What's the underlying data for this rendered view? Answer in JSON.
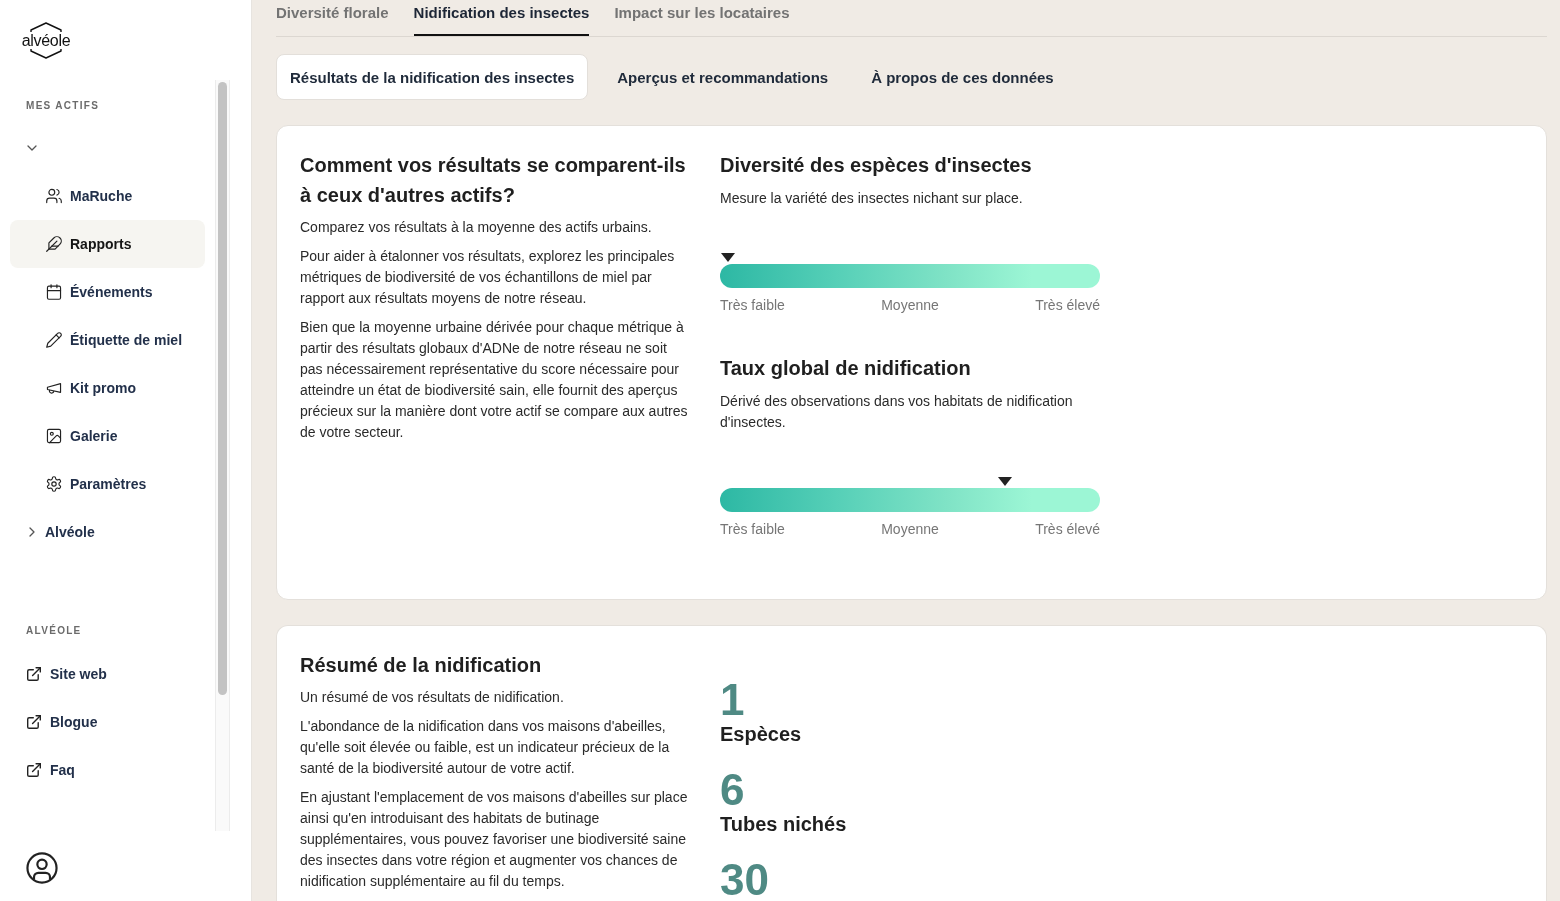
{
  "logo": "alvéole",
  "sidebar": {
    "assets_label": "MES ACTIFS",
    "tree": [
      {
        "expanded": true,
        "children": [
          {
            "label": "MaRuche",
            "selected": false
          },
          {
            "label": "Rapports",
            "selected": true
          },
          {
            "label": "Événements",
            "selected": false
          },
          {
            "label": "Étiquette de miel",
            "selected": false
          },
          {
            "label": "Kit promo",
            "selected": false
          },
          {
            "label": "Galerie",
            "selected": false
          },
          {
            "label": "Paramètres",
            "selected": false
          }
        ]
      },
      {
        "label": "Alvéole",
        "expanded": false
      }
    ],
    "links_label": "ALVÉOLE",
    "links": [
      "Site web",
      "Blogue",
      "Faq"
    ]
  },
  "tabs": [
    {
      "label": "Diversité florale",
      "selected": false
    },
    {
      "label": "Nidification des insectes",
      "selected": true
    },
    {
      "label": "Impact sur les locataires",
      "selected": false
    }
  ],
  "subtabs": [
    {
      "label": "Résultats de la nidification des insectes",
      "selected": true
    },
    {
      "label": "Aperçus et recommandations",
      "selected": false
    },
    {
      "label": "À propos de ces données",
      "selected": false
    }
  ],
  "comparison": {
    "title": "Comment vos résultats se comparent-ils à ceux d'autres actifs?",
    "paragraphs": [
      "Comparez vos résultats à la moyenne des actifs urbains.",
      "Pour aider à étalonner vos résultats, explorez les principales métriques de biodiversité de vos échantillons de miel par rapport aux résultats moyens de notre réseau.",
      "Bien que la moyenne urbaine dérivée pour chaque métrique à partir des résultats globaux d'ADNe de notre réseau ne soit pas nécessairement représentative du score nécessaire pour atteindre un état de biodiversité sain, elle fournit des aperçus précieux sur la manière dont votre actif se compare aux autres de votre secteur."
    ],
    "metrics": [
      {
        "title": "Diversité des espèces d'insectes",
        "description": "Mesure la variété des insectes nichant sur place.",
        "level": 0.02,
        "scale_labels": [
          "Très faible",
          "Moyenne",
          "Très élevé"
        ]
      },
      {
        "title": "Taux global de nidification",
        "description": "Dérivé des observations dans vos habitats de nidification d'insectes.",
        "level": 0.75,
        "scale_labels": [
          "Très faible",
          "Moyenne",
          "Très élevé"
        ]
      }
    ]
  },
  "summary": {
    "title": "Résumé de la nidification",
    "paragraphs": [
      "Un résumé de vos résultats de nidification.",
      "L'abondance de la nidification dans vos maisons d'abeilles, qu'elle soit élevée ou faible, est un indicateur précieux de la santé de la biodiversité autour de votre actif.",
      "En ajustant l'emplacement de vos maisons d'abeilles sur place ainsi qu'en introduisant des habitats de butinage supplémentaires, vous pouvez favoriser une biodiversité saine des insectes dans votre région et augmenter vos chances de nidification supplémentaire au fil du temps."
    ],
    "stats": [
      {
        "value": "1",
        "label": "Espèces"
      },
      {
        "value": "6",
        "label": "Tubes nichés"
      },
      {
        "value": "30"
      }
    ]
  }
}
